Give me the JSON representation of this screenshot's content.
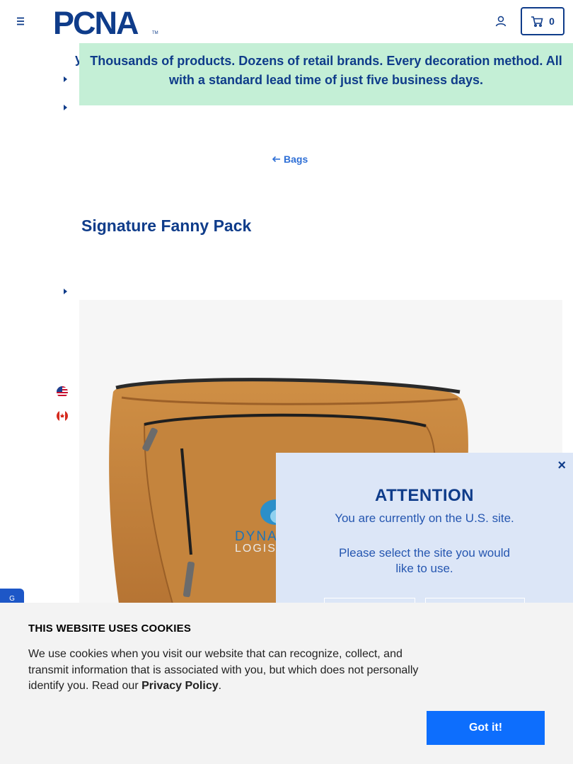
{
  "header": {
    "logo_text": "PCNA",
    "logo_mark": "TM",
    "cart_count": "0"
  },
  "banner": {
    "text": "Thousands of products. Dozens of retail brands. Every decoration method. All with a standard lead time of just five business days.",
    "clip_text": "y"
  },
  "breadcrumb": {
    "back_label": "Bags"
  },
  "product": {
    "title": "Signature Fanny Pack",
    "imprint_line1": "DYNA",
    "imprint_line2": "LOGIST",
    "bag_color": "#c0803a"
  },
  "modal": {
    "close_label": "×",
    "title": "ATTENTION",
    "line1": "You are currently on the U.S. site.",
    "line2": "Please select the site you would like to use."
  },
  "cookies": {
    "title": "THIS WEBSITE USES COOKIES",
    "text_before": "We use cookies when you visit our website that can recognize, collect, and transmit information that is associated with you, but which does not personally identify you. Read our ",
    "link": "Privacy Policy",
    "text_after": ".",
    "button": "Got it!"
  },
  "side_tab": {
    "label": "G"
  },
  "colors": {
    "brand_navy": "#0f3c8a",
    "banner_bg": "#c4efd6",
    "modal_bg": "#dce6f7",
    "button_blue": "#0d6efd"
  },
  "icons": [
    "menu-icon",
    "user-icon",
    "cart-icon",
    "arrow-left-icon",
    "caret-right-icon",
    "us-flag-icon",
    "ca-flag-icon",
    "close-icon"
  ]
}
